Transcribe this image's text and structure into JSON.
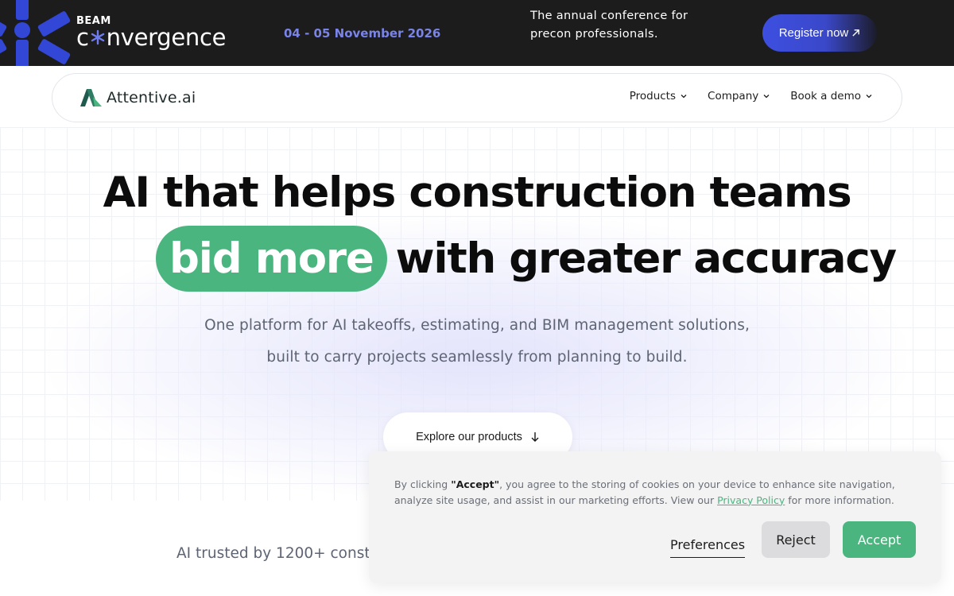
{
  "banner": {
    "logo_top": "BEAM",
    "logo_main_prefix": "c",
    "logo_main_suffix": "nvergence",
    "date": "04 - 05 November 2026",
    "description": "The annual conference for precon professionals.",
    "register_label": "Register now",
    "register_icon": "arrow-up-right-icon",
    "accent_color": "#7a84e8"
  },
  "nav": {
    "brand": "Attentive.ai",
    "items": [
      {
        "label": "Products"
      },
      {
        "label": "Company"
      },
      {
        "label": "Book a demo"
      }
    ]
  },
  "hero": {
    "title_line1": "AI that helps construction teams",
    "highlight": "bid more",
    "title_line2_rest": "with greater accuracy",
    "subtitle_line1": "One platform for AI takeoffs, estimating, and BIM management solutions,",
    "subtitle_line2": "built to carry projects seamlessly from planning to build.",
    "cta_label": "Explore our products",
    "highlight_color": "#4ab57e"
  },
  "trusted": {
    "text": "AI trusted by 1200+ const"
  },
  "cookie": {
    "text_prefix": "By clicking ",
    "accept_quote": "\"Accept\"",
    "text_middle": ", you agree to the storing of cookies on your device to enhance site navigation, analyze site usage, and assist in our marketing efforts. View our ",
    "policy_link": "Privacy Policy",
    "text_suffix": " for more information.",
    "preferences_label": "Preferences",
    "reject_label": "Reject",
    "accept_label": "Accept"
  }
}
